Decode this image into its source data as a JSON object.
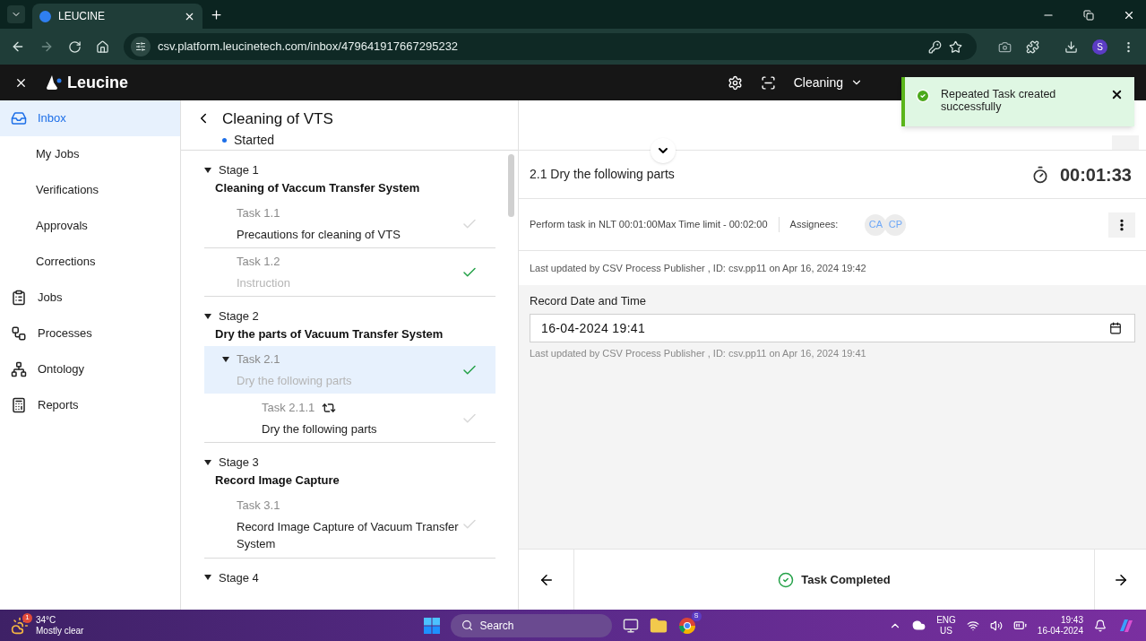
{
  "browser": {
    "tab_title": "LEUCINE",
    "url": "csv.platform.leucinetech.com/inbox/479641917667295232",
    "profile": "S"
  },
  "header": {
    "brand": "Leucine",
    "facility": "Cleaning"
  },
  "toast": {
    "message": "Repeated Task created successfully"
  },
  "sidebar": {
    "items": [
      {
        "label": "Inbox",
        "kind": "main",
        "selected": true
      },
      {
        "label": "My Jobs",
        "kind": "sub",
        "selected": false
      },
      {
        "label": "Verifications",
        "kind": "sub",
        "selected": false
      },
      {
        "label": "Approvals",
        "kind": "sub",
        "selected": false
      },
      {
        "label": "Corrections",
        "kind": "sub",
        "selected": false
      },
      {
        "label": "Jobs",
        "kind": "main",
        "selected": false
      },
      {
        "label": "Processes",
        "kind": "main",
        "selected": false
      },
      {
        "label": "Ontology",
        "kind": "main",
        "selected": false
      },
      {
        "label": "Reports",
        "kind": "main",
        "selected": false
      }
    ]
  },
  "process": {
    "title": "Cleaning of VTS",
    "status": "Started"
  },
  "stages": [
    {
      "label": "Stage 1",
      "title": "Cleaning of Vaccum Transfer System",
      "expanded": true,
      "tasks": [
        {
          "label": "Task 1.1",
          "title": "Precautions for cleaning of VTS",
          "done": false,
          "selected": false
        },
        {
          "label": "Task 1.2",
          "title": "Instruction",
          "done": true,
          "selected": false
        }
      ]
    },
    {
      "label": "Stage 2",
      "title": "Dry the parts of Vacuum Transfer System",
      "expanded": true,
      "tasks": [
        {
          "label": "Task 2.1",
          "title": "Dry the following parts",
          "done": true,
          "selected": true,
          "expanded": true,
          "children": [
            {
              "label": "Task 2.1.1",
              "title": "Dry the following parts",
              "done": false,
              "selected": false,
              "repeated": true
            }
          ]
        }
      ]
    },
    {
      "label": "Stage 3",
      "title": "Record Image Capture",
      "expanded": true,
      "tasks": [
        {
          "label": "Task 3.1",
          "title": "Record Image Capture of Vacuum Transfer System",
          "done": false,
          "selected": false
        }
      ]
    },
    {
      "label": "Stage 4",
      "expanded": true
    }
  ],
  "detail": {
    "heading": "2.1 Dry the following parts",
    "timer": "00:01:33",
    "constraint": "Perform task in NLT 00:01:00Max Time limit - 00:02:00",
    "assignees_label": "Assignees:",
    "assignees": [
      "CA",
      "CP"
    ],
    "last_updated": "Last updated by CSV Process Publisher , ID: csv.pp11 on Apr 16, 2024 19:42",
    "field": {
      "label": "Record Date and Time",
      "value": "16-04-2024 19:41",
      "note": "Last updated by CSV Process Publisher , ID: csv.pp11 on Apr 16, 2024 19:41"
    },
    "footer_status": "Task Completed"
  },
  "taskbar": {
    "temperature": "34°C",
    "weather": "Mostly clear",
    "weather_badge": "1",
    "search": "Search",
    "chrome_badge": "S",
    "language": "ENG",
    "region": "US",
    "time": "19:43",
    "date": "16-04-2024"
  }
}
